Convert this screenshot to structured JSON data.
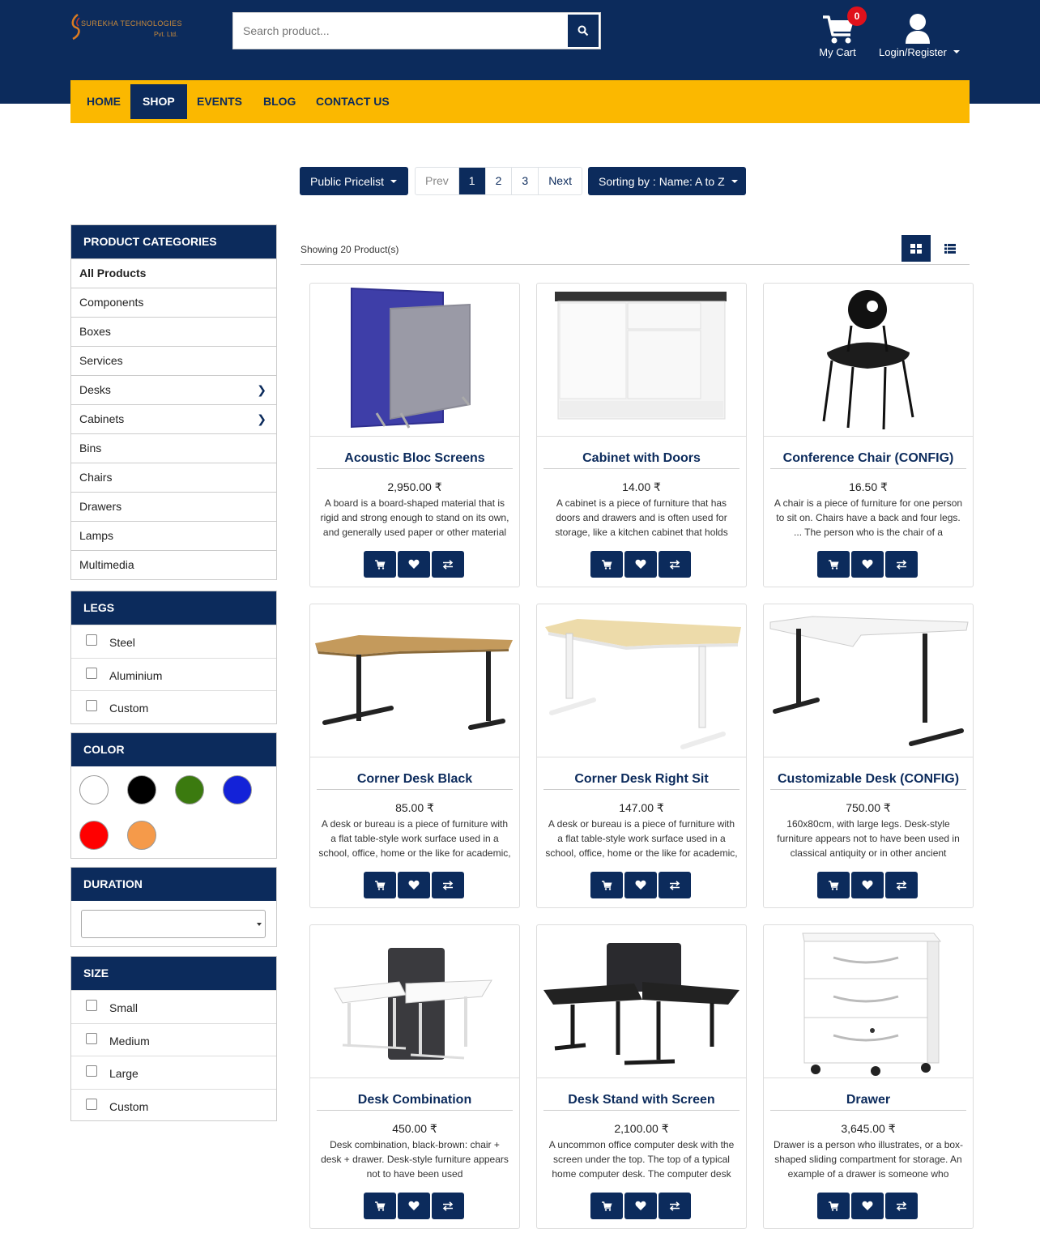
{
  "header": {
    "logo_name": "SUREKHA TECHNOLOGIES",
    "logo_sub": "Pvt. Ltd.",
    "search_placeholder": "Search product...",
    "cart_label": "My Cart",
    "cart_count": "0",
    "login_label": "Login/Register"
  },
  "nav": [
    "HOME",
    "SHOP",
    "EVENTS",
    "BLOG",
    "CONTACT US"
  ],
  "nav_active": "SHOP",
  "toolbar": {
    "pricelist": "Public Pricelist",
    "pager": [
      "Prev",
      "1",
      "2",
      "3",
      "Next"
    ],
    "pager_active": "1",
    "sorting": "Sorting by : Name: A to Z"
  },
  "categories": {
    "title": "PRODUCT CATEGORIES",
    "items": [
      "All Products",
      "Components",
      "Boxes",
      "Services",
      "Desks",
      "Cabinets",
      "Bins",
      "Chairs",
      "Drawers",
      "Lamps",
      "Multimedia"
    ]
  },
  "legs": {
    "title": "LEGS",
    "options": [
      "Steel",
      "Aluminium",
      "Custom"
    ]
  },
  "color": {
    "title": "COLOR",
    "swatches": [
      "#ffffff",
      "#000000",
      "#3b7a0f",
      "#1322d8",
      "#ff0000",
      "#f59a4a"
    ]
  },
  "duration": {
    "title": "DURATION",
    "value": ""
  },
  "size": {
    "title": "SIZE",
    "options": [
      "Small",
      "Medium",
      "Large",
      "Custom"
    ]
  },
  "showing": "Showing 20 Product(s)",
  "products": [
    {
      "name": "Acoustic Bloc Screens",
      "price": "2,950.00 ₹",
      "desc": "A board is a board-shaped material that is rigid and strong enough to stand on its own, and generally used paper or other material",
      "img": "screens"
    },
    {
      "name": "Cabinet with Doors",
      "price": "14.00 ₹",
      "desc": "A cabinet is a piece of furniture that has doors and drawers and is often used for storage, like a kitchen cabinet that holds your",
      "img": "cabinet"
    },
    {
      "name": "Conference Chair (CONFIG)",
      "price": "16.50 ₹",
      "desc": "A chair is a piece of furniture for one person to sit on. Chairs have a back and four legs. ... The person who is the chair of a committee",
      "img": "chair"
    },
    {
      "name": "Corner Desk Black",
      "price": "85.00 ₹",
      "desc": "A desk or bureau is a piece of furniture with a flat table-style work surface used in a school, office, home or the like for academic, professional",
      "img": "desk-oak"
    },
    {
      "name": "Corner Desk Right Sit",
      "price": "147.00 ₹",
      "desc": "A desk or bureau is a piece of furniture with a flat table-style work surface used in a school, office, home or the like for academic, professional",
      "img": "desk-birch"
    },
    {
      "name": "Customizable Desk (CONFIG)",
      "price": "750.00 ₹",
      "desc": "160x80cm, with large legs. Desk-style furniture appears not to have been used in classical antiquity or in other ancient",
      "img": "desk-white"
    },
    {
      "name": "Desk Combination",
      "price": "450.00 ₹",
      "desc": "Desk combination, black-brown: chair + desk + drawer. Desk-style furniture appears not to have been used",
      "img": "desk-combo"
    },
    {
      "name": "Desk Stand with Screen",
      "price": "2,100.00 ₹",
      "desc": "A uncommon office computer desk with the screen under the top. The top of a typical home computer desk. The computer desk",
      "img": "desk-stand"
    },
    {
      "name": "Drawer",
      "price": "3,645.00 ₹",
      "desc": "Drawer is a person who illustrates, or a box-shaped sliding compartment for storage. An example of a drawer is someone who creates",
      "img": "drawer"
    }
  ]
}
